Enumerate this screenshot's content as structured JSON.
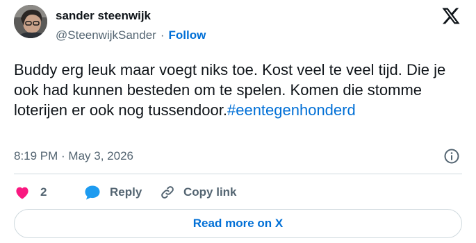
{
  "author": {
    "display_name": "sander steenwijk",
    "handle": "@SteenwijkSander",
    "separator": "·",
    "follow_label": "Follow"
  },
  "tweet": {
    "text": "Buddy erg leuk maar voegt niks toe. Kost veel te veel tijd. Die je ook had kunnen besteden om te spelen. Komen die stomme loterijen er ook nog tussendoor.",
    "hashtag": "#eentegenhonderd",
    "timestamp": "8:19 PM · May 3, 2026"
  },
  "actions": {
    "like_count": "2",
    "reply_label": "Reply",
    "copy_link_label": "Copy link"
  },
  "footer": {
    "read_more_label": "Read more on X"
  },
  "icons": {
    "brand": "x-logo-icon",
    "like": "heart-icon",
    "reply": "speech-bubble-icon",
    "copy": "link-icon",
    "info": "info-icon"
  },
  "colors": {
    "link_blue": "#006fd6",
    "like_pink": "#f91880",
    "reply_blue": "#1d9bf0",
    "muted_gray": "#536471",
    "text_dark": "#0f1419",
    "border": "#cfd9de"
  }
}
